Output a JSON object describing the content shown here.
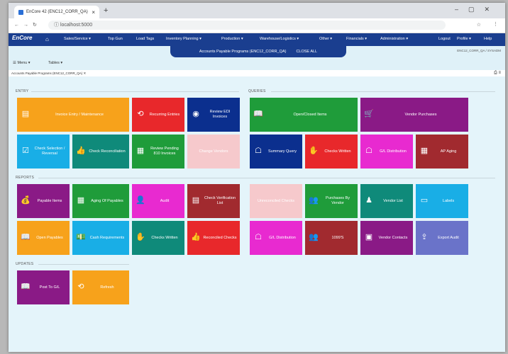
{
  "browser": {
    "tab_title": "EnCore 42 (ENC12_CORR_QA)",
    "url": "localhost:5000"
  },
  "appnav": {
    "logo": "EnCore",
    "items": [
      "Sales/Service ▾",
      "Top Gun",
      "Load Tags",
      "Inventory Planning ▾",
      "Production ▾",
      "Warehouse/Logistics ▾",
      "Other ▾",
      "Financials ▾",
      "Administration ▾",
      "Logout",
      "Profile ▾",
      "Help"
    ]
  },
  "subbar": {
    "tab_label": "Accounts Payable Programs (ENC12_CORR_QA)",
    "close_all": "CLOSE ALL",
    "user_info": "ENC12_CORR_QA / SYSADM"
  },
  "menubar": {
    "menu": "Menu ▾",
    "tables": "Tables ▾"
  },
  "breadcrumb": "Accounts Payable Programs (ENC12_CORR_QA) ✕",
  "sections": {
    "entry": "ENTRY",
    "queries": "QUERIES",
    "reports": "REPORTS",
    "updates": "UPDATES"
  },
  "tiles": {
    "invoice_entry": "Invoice Entry / Maintenance",
    "recurring_entries": "Recurring Entries",
    "review_edi": "Review EDI Invoices",
    "check_selection": "Check Selection / Reversal",
    "check_reconciliation": "Check Reconciliation",
    "review_pending_810": "Review Pending 810 Invoices",
    "change_vendors": "Change Vendors",
    "open_closed_items": "Open/Closed Items",
    "vendor_purchases": "Vendor Purchases",
    "summary_query": "Summary Query",
    "checks_written_q": "Checks Written",
    "gl_distribution_q": "G/L Distribution",
    "ap_aging": "AP Aging",
    "payable_items": "Payable Items",
    "aging_of_payables": "Aging Of Payables",
    "audit": "Audit",
    "check_verification_list": "Check Verification List",
    "unreconciled_checks": "Unreconciled Checks",
    "purchases_by_vendor": "Purchases By Vendor",
    "vendor_list": "Vendor List",
    "labels": "Labels",
    "open_payables": "Open Payables",
    "cash_requirements": "Cash Requirements",
    "checks_written_r": "Checks Written",
    "reconciled_checks": "Reconciled Checks",
    "gl_distribution_r": "G/L Distribution",
    "form_1099": "1099'S",
    "vendor_contacts": "Vendor Contacts",
    "export_audit": "Export Audit",
    "post_to_gl": "Post To G/L",
    "refresh": "Refresh"
  },
  "colors": {
    "nav": "#1a3e8f",
    "orange": "#f7a21b",
    "red": "#e8282b",
    "navy": "#0b2f8e",
    "cyan": "#19aee6",
    "teal": "#0f8a7a",
    "green": "#1f9c3a",
    "purple": "#8a1a86",
    "magenta": "#e82ad0",
    "maroon": "#a12a2f",
    "violet": "#6a73c9"
  }
}
